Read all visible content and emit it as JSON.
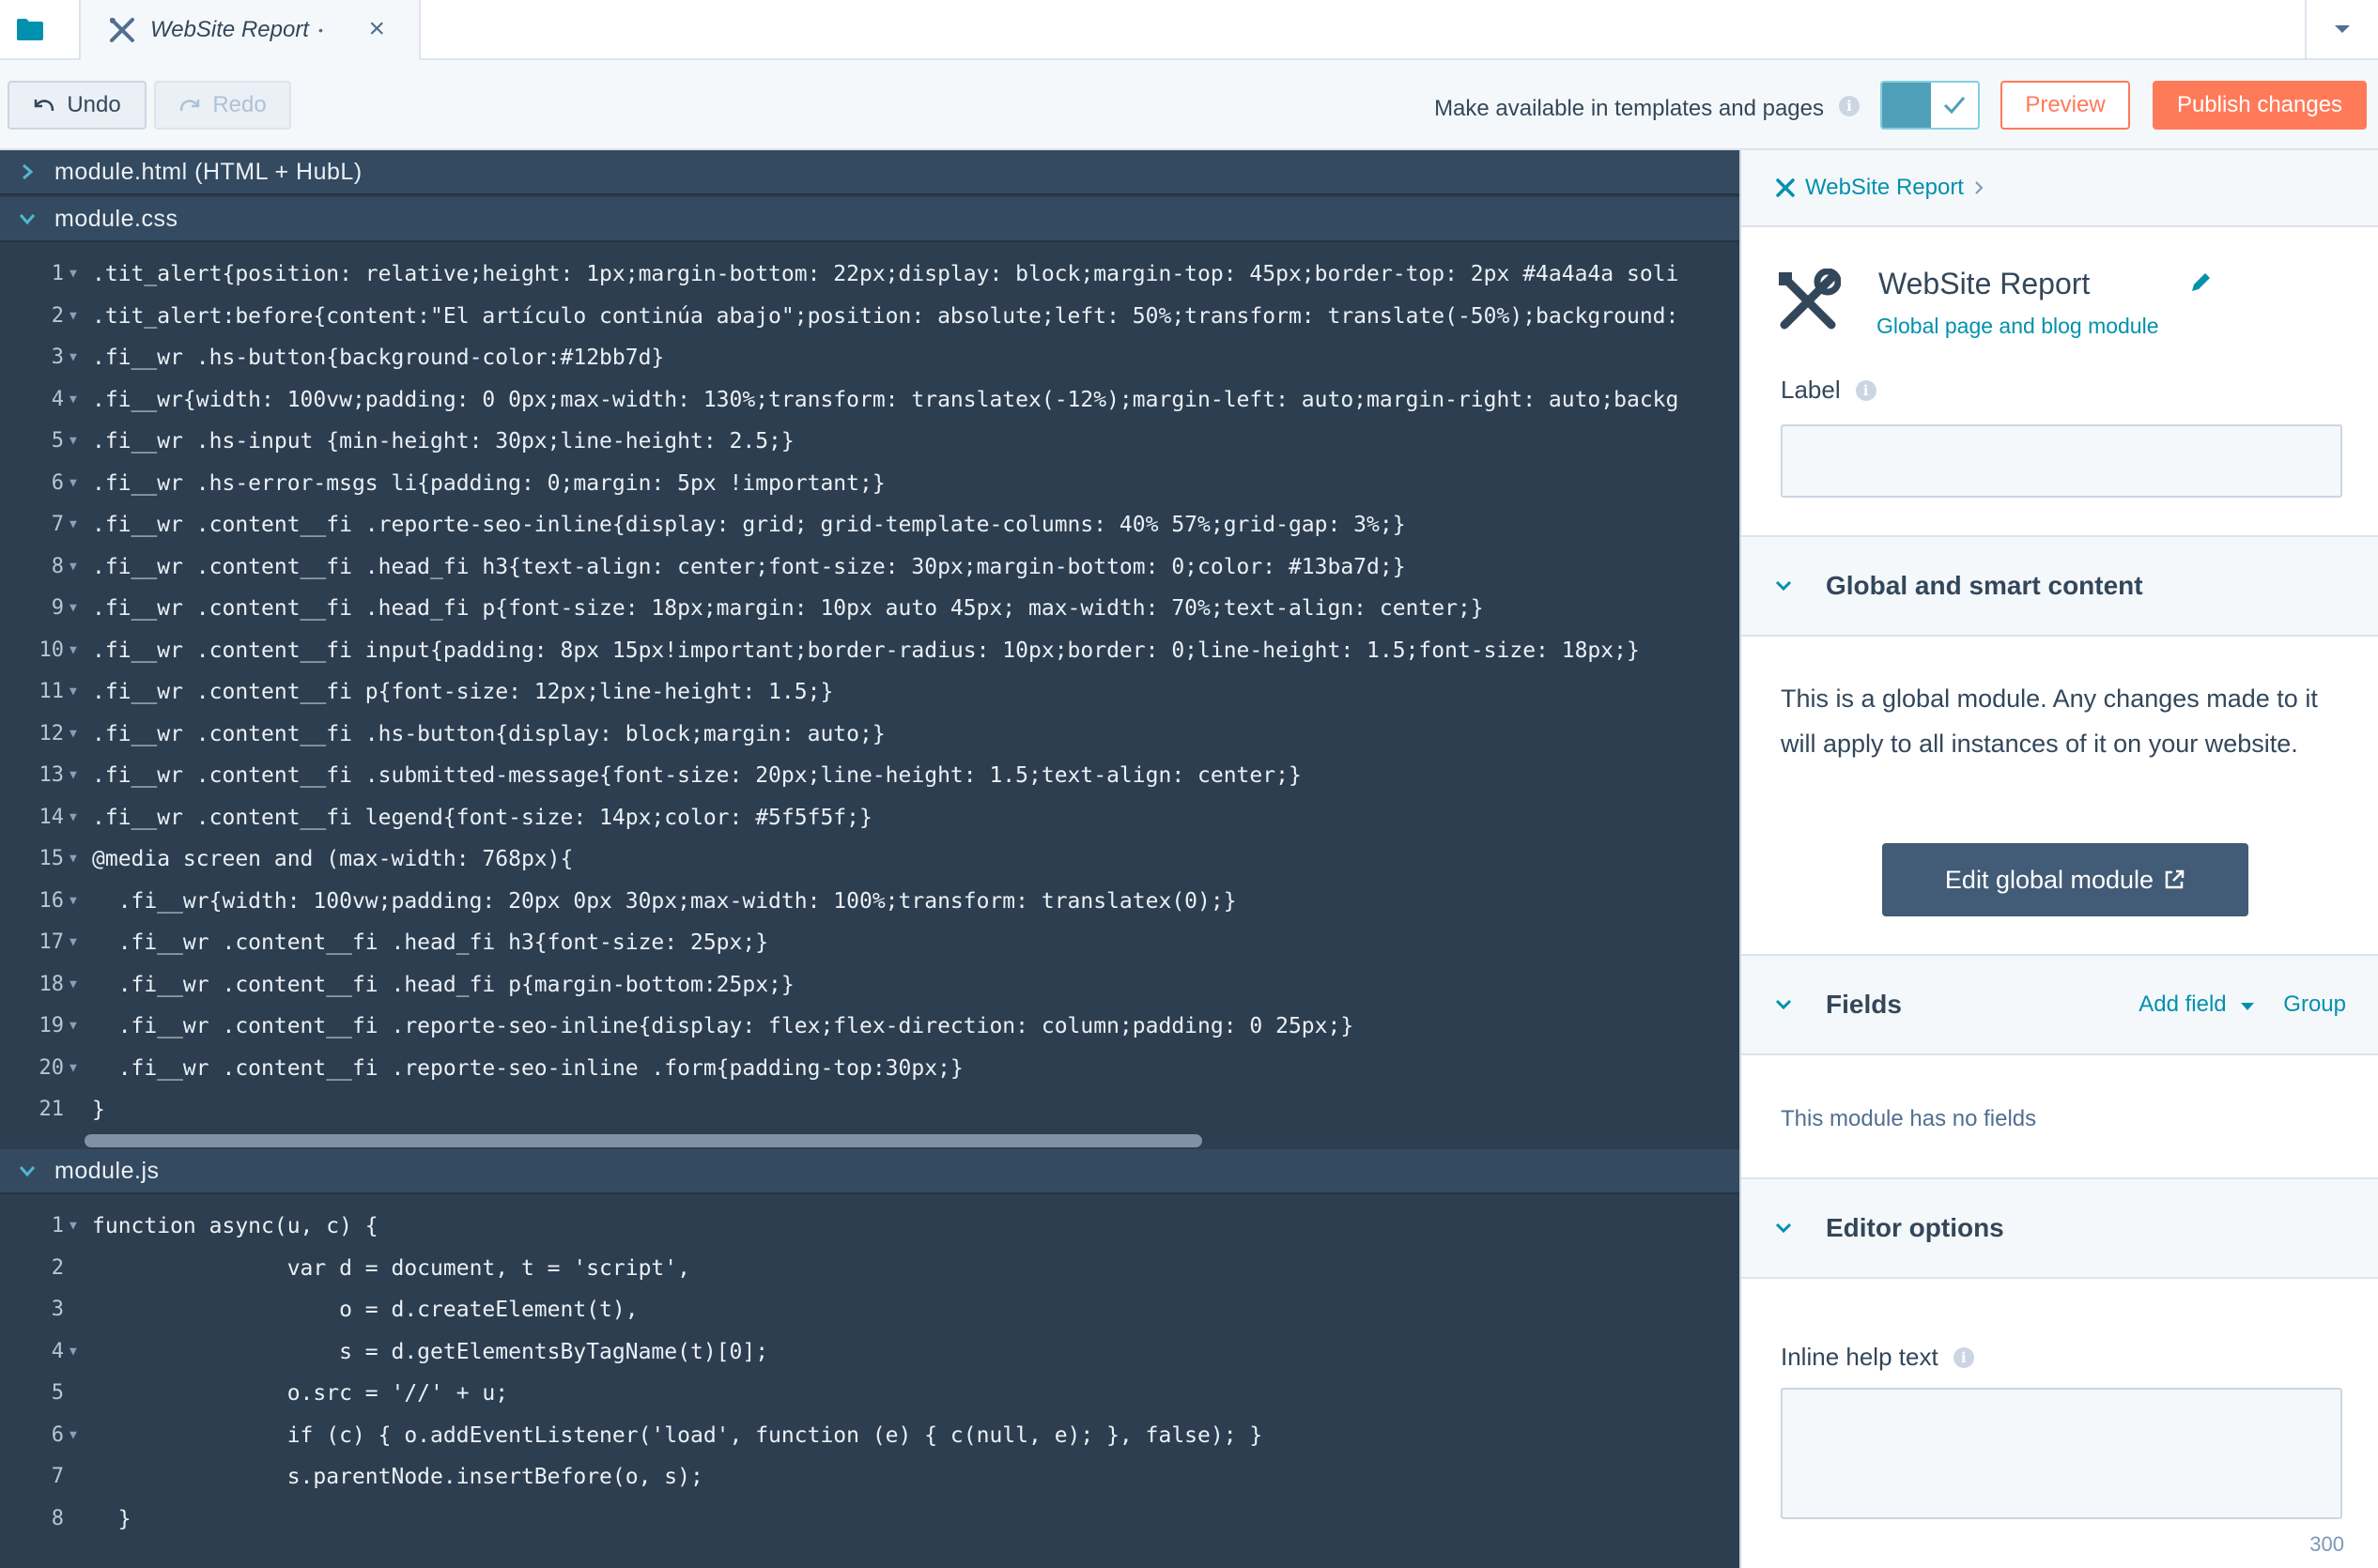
{
  "tabbar": {
    "tab_title": "WebSite Report",
    "tab_dirty_mark": "•",
    "tab_close": "×"
  },
  "toolbar": {
    "undo_label": "Undo",
    "redo_label": "Redo",
    "availability_label": "Make available in templates and pages",
    "availability_enabled": true,
    "preview_label": "Preview",
    "publish_label": "Publish changes"
  },
  "files": {
    "html": {
      "name": "module.html (HTML + HubL)",
      "expanded": false
    },
    "css": {
      "name": "module.css",
      "expanded": true,
      "lines": [
        ".tit_alert{position: relative;height: 1px;margin-bottom: 22px;display: block;margin-top: 45px;border-top: 2px #4a4a4a soli",
        ".tit_alert:before{content:\"El artículo continúa abajo\";position: absolute;left: 50%;transform: translate(-50%);background:",
        ".fi__wr .hs-button{background-color:#12bb7d}",
        ".fi__wr{width: 100vw;padding: 0 0px;max-width: 130%;transform: translatex(-12%);margin-left: auto;margin-right: auto;backg",
        ".fi__wr .hs-input {min-height: 30px;line-height: 2.5;}",
        ".fi__wr .hs-error-msgs li{padding: 0;margin: 5px !important;}",
        ".fi__wr .content__fi .reporte-seo-inline{display: grid; grid-template-columns: 40% 57%;grid-gap: 3%;}",
        ".fi__wr .content__fi .head_fi h3{text-align: center;font-size: 30px;margin-bottom: 0;color: #13ba7d;}",
        ".fi__wr .content__fi .head_fi p{font-size: 18px;margin: 10px auto 45px; max-width: 70%;text-align: center;}",
        ".fi__wr .content__fi input{padding: 8px 15px!important;border-radius: 10px;border: 0;line-height: 1.5;font-size: 18px;}",
        ".fi__wr .content__fi p{font-size: 12px;line-height: 1.5;}",
        ".fi__wr .content__fi .hs-button{display: block;margin: auto;}",
        ".fi__wr .content__fi .submitted-message{font-size: 20px;line-height: 1.5;text-align: center;}",
        ".fi__wr .content__fi legend{font-size: 14px;color: #5f5f5f;}",
        "@media screen and (max-width: 768px){",
        "  .fi__wr{width: 100vw;padding: 20px 0px 30px;max-width: 100%;transform: translatex(0);}",
        "  .fi__wr .content__fi .head_fi h3{font-size: 25px;}",
        "  .fi__wr .content__fi .head_fi p{margin-bottom:25px;}",
        "  .fi__wr .content__fi .reporte-seo-inline{display: flex;flex-direction: column;padding: 0 25px;}",
        "  .fi__wr .content__fi .reporte-seo-inline .form{padding-top:30px;}",
        "}"
      ],
      "foldable_lines": [
        1,
        2,
        3,
        4,
        5,
        6,
        7,
        8,
        9,
        10,
        11,
        12,
        13,
        14,
        15,
        16,
        17,
        18,
        19,
        20
      ]
    },
    "js": {
      "name": "module.js",
      "expanded": true,
      "lines": [
        "function async(u, c) {",
        "               var d = document, t = 'script',",
        "                   o = d.createElement(t),",
        "                   s = d.getElementsByTagName(t)[0];",
        "               o.src = '//' + u;",
        "               if (c) { o.addEventListener('load', function (e) { c(null, e); }, false); }",
        "               s.parentNode.insertBefore(o, s);",
        "  }"
      ],
      "foldable_lines": [
        1,
        4,
        6
      ]
    }
  },
  "sidebar": {
    "breadcrumb": "WebSite Report",
    "module_title": "WebSite Report",
    "module_subtitle": "Global page and blog module",
    "label_field": {
      "label": "Label",
      "value": ""
    },
    "global_section": {
      "title": "Global and smart content",
      "note": "This is a global module. Any changes made to it will apply to all instances of it on your website.",
      "edit_button": "Edit global module"
    },
    "fields_section": {
      "title": "Fields",
      "add_field": "Add field",
      "group": "Group",
      "empty": "This module has no fields"
    },
    "editor_options": {
      "title": "Editor options",
      "help_label": "Inline help text",
      "help_value": "",
      "char_count": "300"
    }
  },
  "colors": {
    "accent": "#ff7a59",
    "link": "#0091ae",
    "editor_bg": "#2d3e50",
    "dark_button": "#425b76"
  }
}
